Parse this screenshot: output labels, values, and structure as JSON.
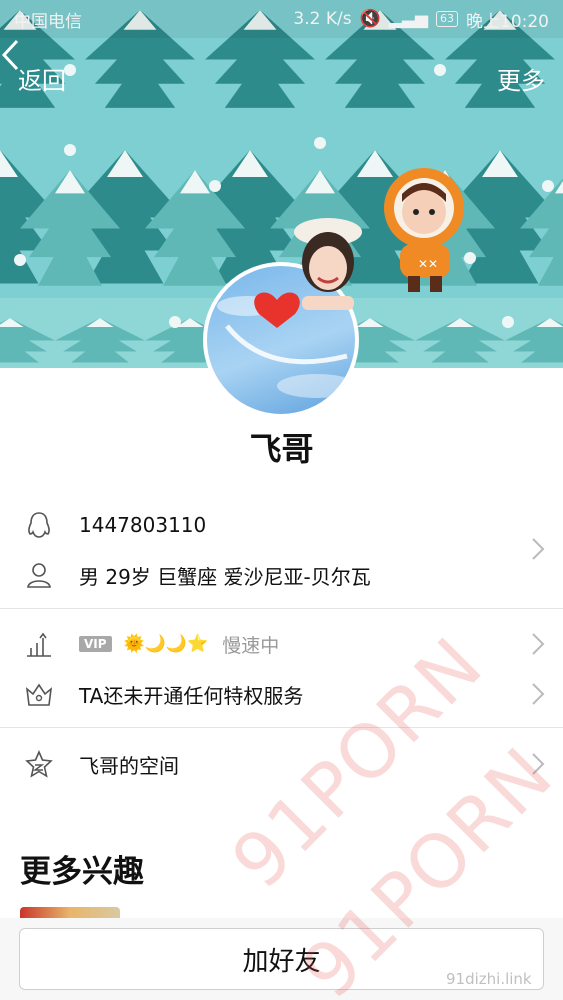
{
  "status_bar": {
    "carrier": "中国电信",
    "speed": "3.2 K/s",
    "battery": "63",
    "time": "晚上10:20"
  },
  "nav": {
    "back_label": "返回",
    "more_label": "更多"
  },
  "profile": {
    "name": "飞哥",
    "qq_number": "1447803110",
    "details": "男  29岁  巨蟹座  爱沙尼亚-贝尔瓦"
  },
  "vip_row": {
    "vip_badge": "VIP",
    "level_icons": "🌞🌙🌙⭐",
    "speed_status": "慢速中"
  },
  "privilege_row": {
    "label": "TA还未开通任何特权服务"
  },
  "space_row": {
    "label": "飞哥的空间"
  },
  "more_interests": {
    "title": "更多兴趣"
  },
  "action": {
    "add_friend_label": "加好友"
  },
  "watermark": {
    "text_1": "91PORN",
    "text_2": "91PORN",
    "site": "91dizhi.link"
  },
  "colors": {
    "banner_bg": "#7ecfd2",
    "tree_dark": "#2e8b8c",
    "tree_light": "#5fb8b6",
    "snow": "#eef7f5"
  }
}
